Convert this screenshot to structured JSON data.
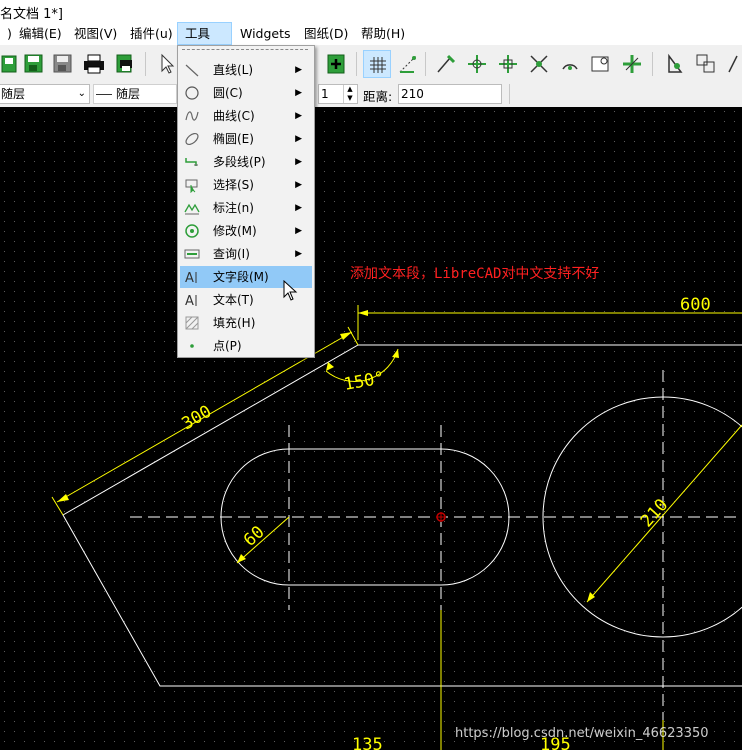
{
  "title": "名文档 1*]",
  "menubar": [
    {
      "label": ")",
      "key": "edge"
    },
    {
      "label": "编辑(E)",
      "key": "edit"
    },
    {
      "label": "视图(V)",
      "key": "view"
    },
    {
      "label": "插件(u)",
      "key": "plugins"
    },
    {
      "label": "工具(T)",
      "key": "tools",
      "active": true
    },
    {
      "label": "Widgets",
      "key": "widgets"
    },
    {
      "label": "图纸(D)",
      "key": "drawings"
    },
    {
      "label": "帮助(H)",
      "key": "help"
    }
  ],
  "propbar": {
    "layer_combo": "随层",
    "linetype_combo": "随层",
    "spin_value": "1",
    "distance_label": "距离:",
    "distance_value": "210"
  },
  "tools_menu": [
    {
      "label": "直线(L)",
      "icon": "line-icon",
      "submenu": true
    },
    {
      "label": "圆(C)",
      "icon": "circle-icon",
      "submenu": true
    },
    {
      "label": "曲线(C)",
      "icon": "curve-icon",
      "submenu": true
    },
    {
      "label": "椭圆(E)",
      "icon": "ellipse-icon",
      "submenu": true
    },
    {
      "label": "多段线(P)",
      "icon": "polyline-icon",
      "submenu": true
    },
    {
      "label": "选择(S)",
      "icon": "select-icon",
      "submenu": true
    },
    {
      "label": "标注(n)",
      "icon": "dimension-icon",
      "submenu": true
    },
    {
      "label": "修改(M)",
      "icon": "modify-icon",
      "submenu": true
    },
    {
      "label": "查询(I)",
      "icon": "info-icon",
      "submenu": true
    },
    {
      "label": "文字段(M)",
      "icon": "mtext-icon",
      "submenu": false,
      "highlighted": true
    },
    {
      "label": "文本(T)",
      "icon": "text-icon",
      "submenu": false
    },
    {
      "label": "填充(H)",
      "icon": "hatch-icon",
      "submenu": false
    },
    {
      "label": "点(P)",
      "icon": "point-icon",
      "submenu": false
    }
  ],
  "drawing": {
    "annotation": "添加文本段，LibreCAD对中文支持不好",
    "dim_600": "600",
    "dim_300": "300",
    "dim_150deg": "150°",
    "dim_60": "60",
    "dim_210": "210",
    "dim_135": "135",
    "dim_195": "195",
    "watermark": "https://blog.csdn.net/weixin_46623350"
  },
  "colors": {
    "canvas_bg": "#000000",
    "geometry": "#ffffff",
    "dimension": "#ffff00",
    "annotation": "#ff2020",
    "menu_highlight": "#91c9f7"
  }
}
